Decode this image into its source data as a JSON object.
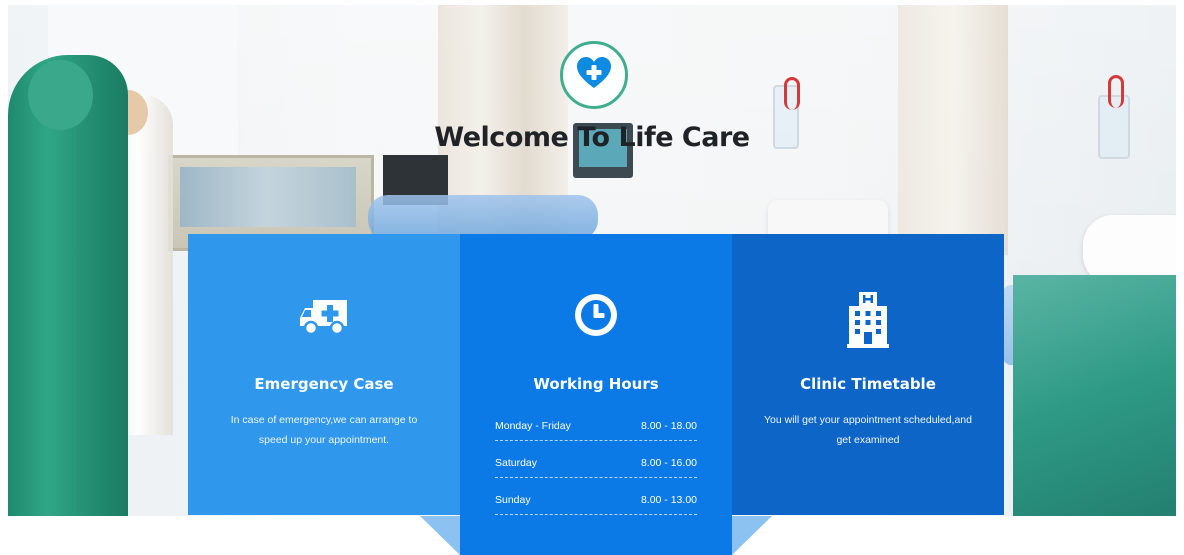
{
  "hero": {
    "title": "Welcome To Life Care",
    "logo_icon": "heart-plus-icon"
  },
  "services": [
    {
      "icon": "ambulance-icon",
      "title": "Emergency Case",
      "text": "In case of emergency,we can arrange to speed up your appointment."
    },
    {
      "icon": "clock-icon",
      "title": "Working Hours",
      "hours": [
        {
          "day": "Monday - Friday",
          "time": "8.00 - 18.00"
        },
        {
          "day": "Saturday",
          "time": "8.00 - 16.00"
        },
        {
          "day": "Sunday",
          "time": "8.00 - 13.00"
        }
      ]
    },
    {
      "icon": "hospital-building-icon",
      "title": "Clinic Timetable",
      "text": "You will get your appointment scheduled,and get examined"
    }
  ],
  "colors": {
    "box1": "#2f97ec",
    "box2": "#0b7ae6",
    "box3": "#0d65c8",
    "logo_ring": "#3fae8f",
    "logo_heart": "#0d8be0"
  }
}
